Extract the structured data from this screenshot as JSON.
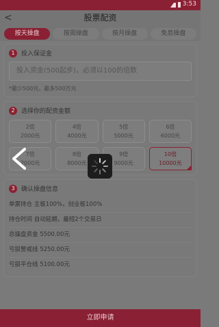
{
  "statusbar": {
    "time": "3:53"
  },
  "header": {
    "back": "<",
    "title": "股票配资"
  },
  "tabs": [
    {
      "label": "按天操盘",
      "active": true
    },
    {
      "label": "按周操盘",
      "active": false
    },
    {
      "label": "按月操盘",
      "active": false
    },
    {
      "label": "免息操盘",
      "active": false
    }
  ],
  "step1": {
    "num": "1",
    "title": "投入保证金",
    "input_placeholder": "投入资金(500起步)，必须以100的倍数",
    "hint": "*最少500元，最多500万元"
  },
  "step2": {
    "num": "2",
    "title": "选择你的配资金额",
    "options": [
      {
        "ratio": "2倍",
        "amount": "2000元",
        "selected": false
      },
      {
        "ratio": "4倍",
        "amount": "4000元",
        "selected": false
      },
      {
        "ratio": "5倍",
        "amount": "5000元",
        "selected": false
      },
      {
        "ratio": "6倍",
        "amount": "6000元",
        "selected": false
      },
      {
        "ratio": "7倍",
        "amount": "7000元",
        "selected": false
      },
      {
        "ratio": "8倍",
        "amount": "8000元",
        "selected": false
      },
      {
        "ratio": "9倍",
        "amount": "9000元",
        "selected": false
      },
      {
        "ratio": "10倍",
        "amount": "10000元",
        "selected": true
      }
    ]
  },
  "step3": {
    "num": "3",
    "title": "确认操盘信息",
    "rows": [
      "单票持仓 主板100%，创业板100%",
      "持仓时间 自动延期，最短2个交易日",
      "总操盘资金 5500.00元",
      "亏损警戒线 5250.00元",
      "亏损平仓线 5100.00元"
    ]
  },
  "submit_label": "立即申请",
  "colors": {
    "accent": "#8a2033"
  }
}
